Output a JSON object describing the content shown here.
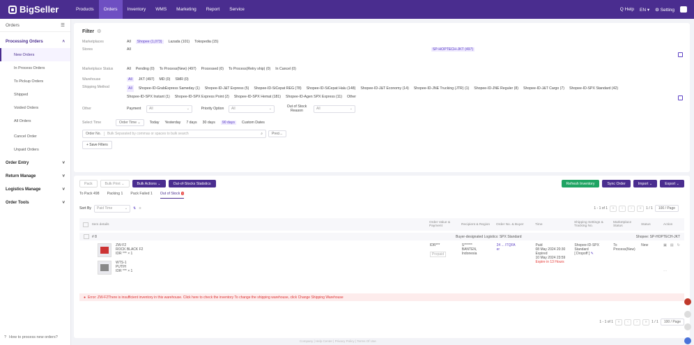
{
  "app": {
    "logo": "BigSeller"
  },
  "nav": [
    "Products",
    "Orders",
    "Inventory",
    "WMS",
    "Marketing",
    "Report",
    "Service"
  ],
  "topright": {
    "help": "Q Help",
    "lang": "EN ▾",
    "setting": "⚙ Setting"
  },
  "sidebar": {
    "header": "Orders",
    "processing": "Processing Orders",
    "items": [
      "New Orders",
      "In Process Orders",
      "To Pickup Orders",
      "Shipped",
      "Voided Orders",
      "All Orders",
      "Cancel Order",
      "Unpaid Orders"
    ],
    "sections": [
      "Order Entry",
      "Return Manage",
      "Logistics Manage",
      "Order Tools"
    ],
    "footer": "How to process new orders?"
  },
  "filter": {
    "title": "Filter",
    "marketplaces_label": "Marketplaces",
    "marketplaces": [
      "All",
      "Shopee (1,073)",
      "Lazada (101)",
      "Tokopedia (15)"
    ],
    "stores_label": "Stores",
    "stores_all": "All",
    "store": "SP-HOPTECH-JKT (497)",
    "status_label": "Marketplace Status",
    "status": [
      "All",
      "Pending (0)",
      "To Process(New) (497)",
      "Processed (0)",
      "To Process(Retry ship) (0)",
      "In Cancel (0)"
    ],
    "warehouse_label": "Warehouse",
    "warehouse": [
      "All",
      "JKT (497)",
      "MD (0)",
      "SMR (0)"
    ],
    "shipping_label": "Shipping Method",
    "shipping": [
      "All",
      "Shopee-ID-GrabExpress Sameday (1)",
      "Shopee-ID-J&T Express (5)",
      "Shopee-ID-SiCepat REG (78)",
      "Shopee-ID-SiCepat Halu (148)",
      "Shopee-ID-J&T Economy (14)",
      "Shopee-ID-JNE Trucking (JTR) (1)",
      "Shopee-ID-JNE Reguler (8)",
      "Shopee-ID-J&T Cargo (7)",
      "Shopee-ID-SPX Standard (42)",
      "Shopee-ID-SPX Instant (1)",
      "Shopee-ID-SPX Express Point (2)",
      "Shopee-ID-SPX Hemat (181)",
      "Shopee-ID-Agen SPX Express (11)",
      "Other"
    ],
    "other_label": "Other",
    "payment_label": "Payment",
    "priority_label": "Priority Option",
    "outstock_label": "Out of Stock Reason",
    "select_all": "All",
    "time_label": "Select Time",
    "time_field": "Order Time",
    "times": [
      "Today",
      "Yesterday",
      "7 days",
      "30 days",
      "90 days",
      "Custom Dates"
    ],
    "order_no": "Order No.",
    "search_placeholder": "Bulk Separated by commas or spaces to bulk search",
    "precise": "Preci...",
    "save": "+ Save Filters"
  },
  "actions": {
    "pack": "Pack",
    "bulk_print": "Bulk Print",
    "bulk_actions": "Bulk Actions",
    "oos_stats": "Out-of-Stocks Statistics",
    "refresh": "Refresh Inventory",
    "sync": "Sync Order",
    "import": "Import",
    "export": "Export"
  },
  "subtabs": [
    {
      "label": "To Pack",
      "count": "498"
    },
    {
      "label": "Packing",
      "count": "1"
    },
    {
      "label": "Pack Failed",
      "count": "1"
    },
    {
      "label": "Out of Stock",
      "count": "1"
    }
  ],
  "sort": {
    "label": "Sort By",
    "value": "Paid Time"
  },
  "pagination": {
    "text": "1 - 1 of 1",
    "pages": "1 / 1",
    "per_page": "100 / Page"
  },
  "table": {
    "headers": [
      "Item details",
      "Order Value & Payment",
      "Recipient & Region",
      "Order No. & Buyer",
      "Time",
      "Shipping Settings & Tracking No.",
      "Marketplace Status",
      "Status",
      "Action"
    ],
    "group": {
      "index": "# 8",
      "logistics": "Buyer-designated Logistics: SPX Standard",
      "store": "Shopee: SP-HOPTECH-JKT"
    },
    "items": [
      {
        "sku": "ZW-F2",
        "name": "ROCK BLACK F2",
        "price": "IDR *** × 1"
      },
      {
        "sku": "WTS-1",
        "name": "PUTIH",
        "price": "IDR *** × 1"
      }
    ],
    "order_value": "IDR***",
    "payment": "Prepaid",
    "recipient": [
      "S******",
      "BANTEN,",
      "Indonesia"
    ],
    "order_no": "24 ... ITQFA",
    "buyer": "er",
    "time": [
      "Paid",
      "08 May 2024 20:30",
      "Expired",
      "10 May 2024 23:59",
      "Expire in 13 Hours"
    ],
    "shipping": [
      "Shopee-ID-SPX",
      "Standard",
      "[ Dropoff ]"
    ],
    "mstatus": [
      "To",
      "Process(New)"
    ],
    "status": "New"
  },
  "error": "Error: ZW-F2There is insufficient inventory in this warehouse. Click here to check the inventory To change the shipping warehouse, click Change Shipping Warehouse",
  "footer": "Company | Help Center | Privacy Policy | Terms Of Use"
}
